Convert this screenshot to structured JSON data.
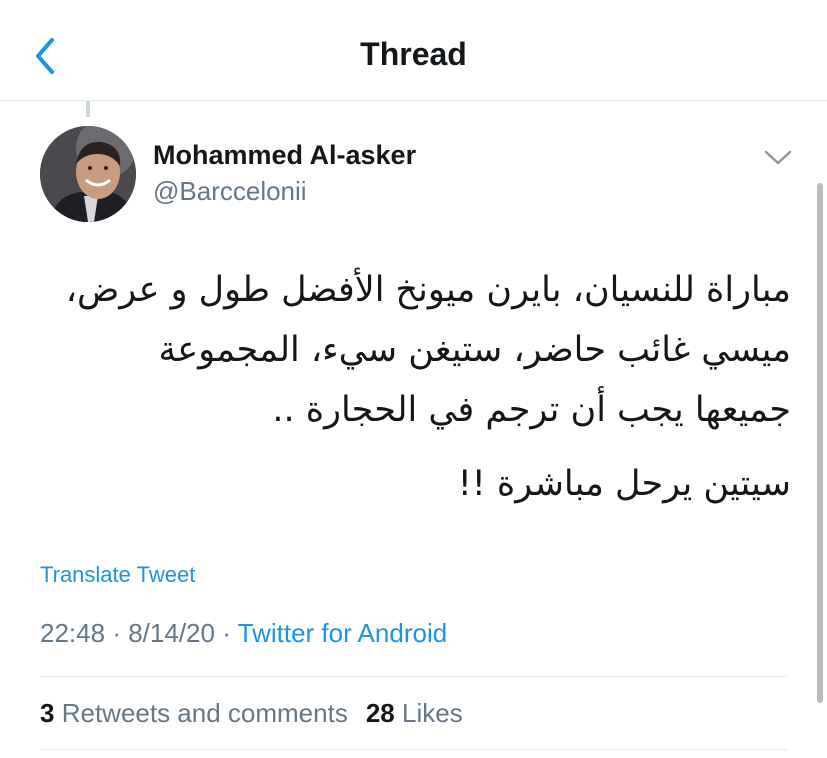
{
  "header": {
    "title": "Thread",
    "back_icon": "chevron-left-icon",
    "accent": "#1b95e0"
  },
  "tweet": {
    "author_name": "Mohammed Al-asker",
    "author_handle": "@Barccelonii",
    "body_paragraph_1": "مباراة للنسيان، بايرن ميونخ الأفضل طول و عرض،\nميسي غائب حاضر، ستيغن سيء، المجموعة\nجميعها يجب أن ترجم في الحجارة ..",
    "body_paragraph_2": "سيتين يرحل مباشرة !!",
    "translate_label": "Translate Tweet",
    "time": "22:48",
    "date": "8/14/20",
    "separator": "·",
    "source": "Twitter for Android"
  },
  "stats": {
    "retweets_count": "3",
    "retweets_label": "Retweets and comments",
    "likes_count": "28",
    "likes_label": "Likes"
  }
}
